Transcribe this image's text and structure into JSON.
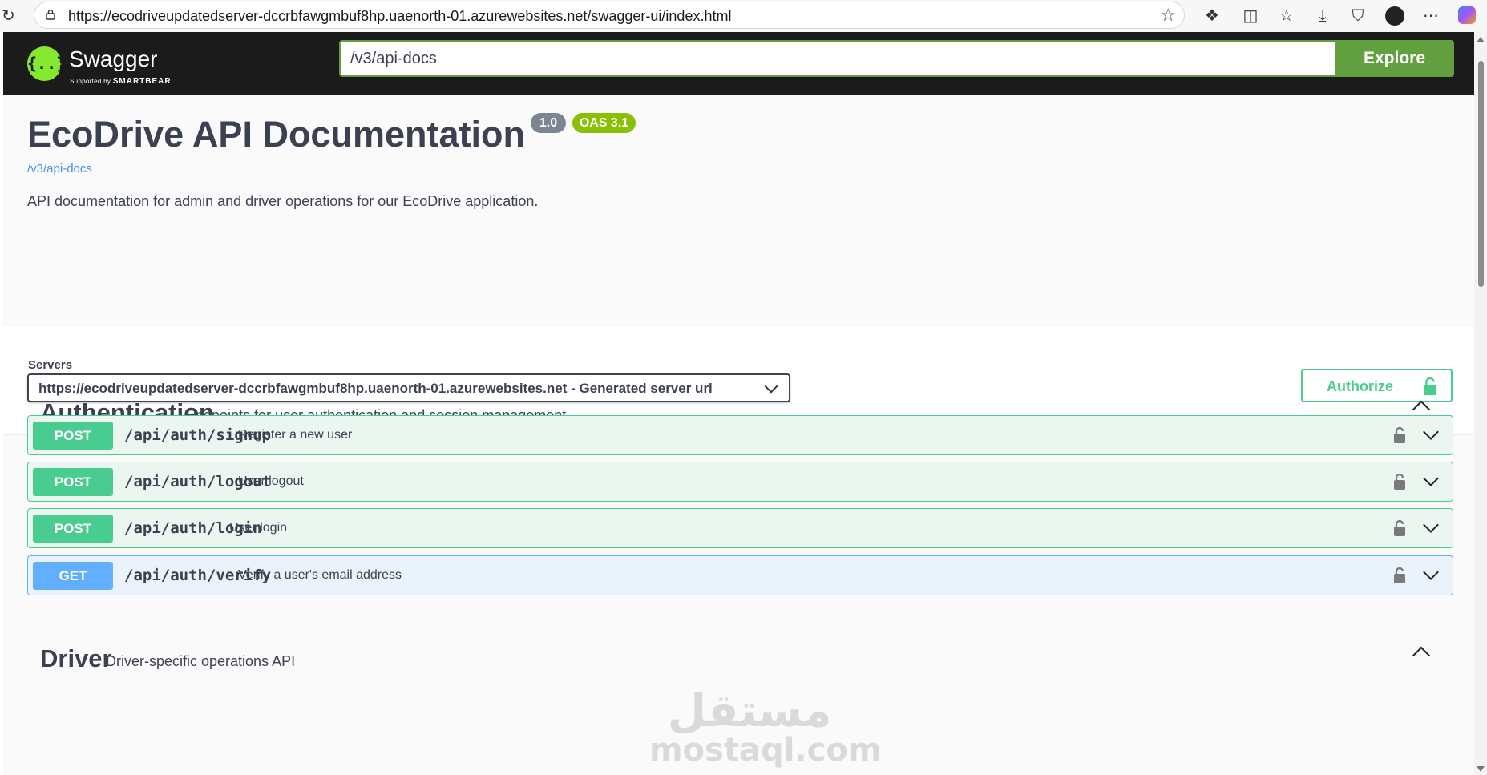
{
  "browser": {
    "url": "https://ecodriveupdatedserver-dccrbfawgmbuf8hp.uaenorth-01.azurewebsites.net/swagger-ui/index.html"
  },
  "topbar": {
    "brand": "Swagger",
    "brand_sub_prefix": "Supported by",
    "brand_sub_company": "SMARTBEAR",
    "explore_value": "/v3/api-docs",
    "explore_label": "Explore"
  },
  "info": {
    "title": "EcoDrive API Documentation",
    "version": "1.0",
    "oas": "OAS 3.1",
    "spec_link": "/v3/api-docs",
    "description": "API documentation for admin and driver operations for our EcoDrive application."
  },
  "schemes": {
    "servers_label": "Servers",
    "selected_server": "https://ecodriveupdatedserver-dccrbfawgmbuf8hp.uaenorth-01.azurewebsites.net - Generated server url",
    "authorize_label": "Authorize"
  },
  "tags": [
    {
      "name": "Authentication",
      "description": "Endpoints for user authentication and session management",
      "operations": [
        {
          "method": "POST",
          "path": "/api/auth/signup",
          "summary": "Register a new user"
        },
        {
          "method": "POST",
          "path": "/api/auth/logout",
          "summary": "User logout"
        },
        {
          "method": "POST",
          "path": "/api/auth/login",
          "summary": "User login"
        },
        {
          "method": "GET",
          "path": "/api/auth/verify",
          "summary": "Verify a user's email address"
        }
      ]
    },
    {
      "name": "Driver",
      "description": "Driver-specific operations API",
      "operations": []
    }
  ],
  "watermark": {
    "arabic": "مستقل",
    "latin": "mostaql.com"
  },
  "colors": {
    "post": "#49cc90",
    "get": "#61affe",
    "topbar": "#1b1b1b",
    "swagger_green": "#85ea2d",
    "explore": "#62a03f"
  }
}
